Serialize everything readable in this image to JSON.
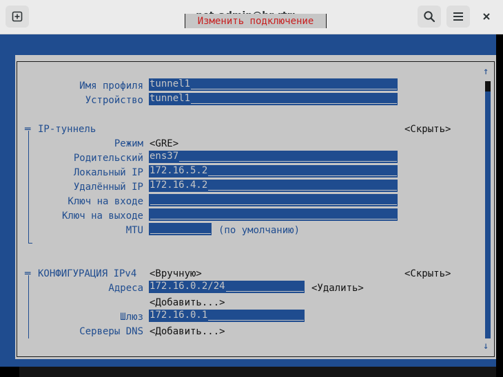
{
  "window": {
    "title": "net_admin@br-rtr: ~",
    "icons": {
      "new_tab": "new-tab-icon",
      "search": "search-icon",
      "menu": "hamburger-menu-icon",
      "close": "close-icon"
    }
  },
  "dialog": {
    "title": "Изменить подключение",
    "scroll_up": "↑",
    "scroll_down": "↓",
    "profile": {
      "name_label": "Имя профиля",
      "name_value": "tunnel1",
      "device_label": "Устройство",
      "device_value": "tunnel1"
    },
    "ip_tunnel": {
      "marker": "═",
      "title": "IP-туннель",
      "hide": "<Скрыть>",
      "mode_label": "Режим",
      "mode_value": "<GRE>",
      "parent_label": "Родительский",
      "parent_value": "ens37",
      "local_label": "Локальный IP",
      "local_value": "172.16.5.2",
      "remote_label": "Удалённый IP",
      "remote_value": "172.16.4.2",
      "ikey_label": "Ключ на входе",
      "ikey_value": "",
      "okey_label": "Ключ на выходе",
      "okey_value": "",
      "mtu_label": "MTU",
      "mtu_value": "",
      "mtu_note": "(по умолчанию)"
    },
    "ipv4": {
      "marker": "═",
      "title": "КОНФИГУРАЦИЯ IPv4",
      "method": "<Вручную>",
      "hide": "<Скрыть>",
      "addresses_label": "Адреса",
      "address_value": "172.16.0.2/24",
      "remove": "<Удалить>",
      "add_address": "<Добавить...>",
      "gateway_label": "Шлюз",
      "gateway_value": "172.16.0.1",
      "dns_label": "Серверы DNS",
      "add_dns": "<Добавить...>"
    }
  }
}
